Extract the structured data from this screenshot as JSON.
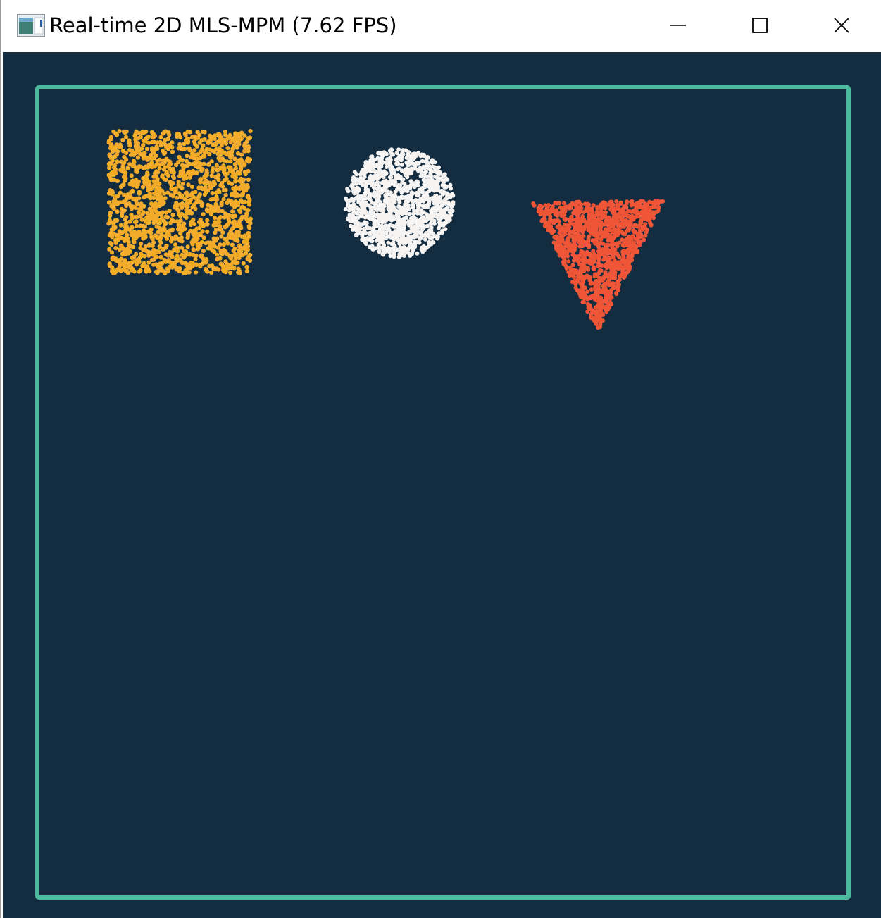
{
  "window": {
    "title": "Real-time 2D MLS-MPM (7.62 FPS)",
    "icon": "app-window-icon",
    "controls": [
      "minimize-icon",
      "maximize-icon",
      "close-icon"
    ]
  },
  "colors": {
    "background": "#132c40",
    "boundary": "#4bb99c",
    "square_particles": "#f2ac2a",
    "circle_particles": "#f6f4f3",
    "triangle_particles": "#ef5537"
  },
  "scene": {
    "bodies": [
      {
        "shape": "square",
        "color": "#f2ac2a"
      },
      {
        "shape": "circle",
        "color": "#f6f4f3"
      },
      {
        "shape": "inverted-triangle",
        "color": "#ef5537"
      }
    ]
  }
}
